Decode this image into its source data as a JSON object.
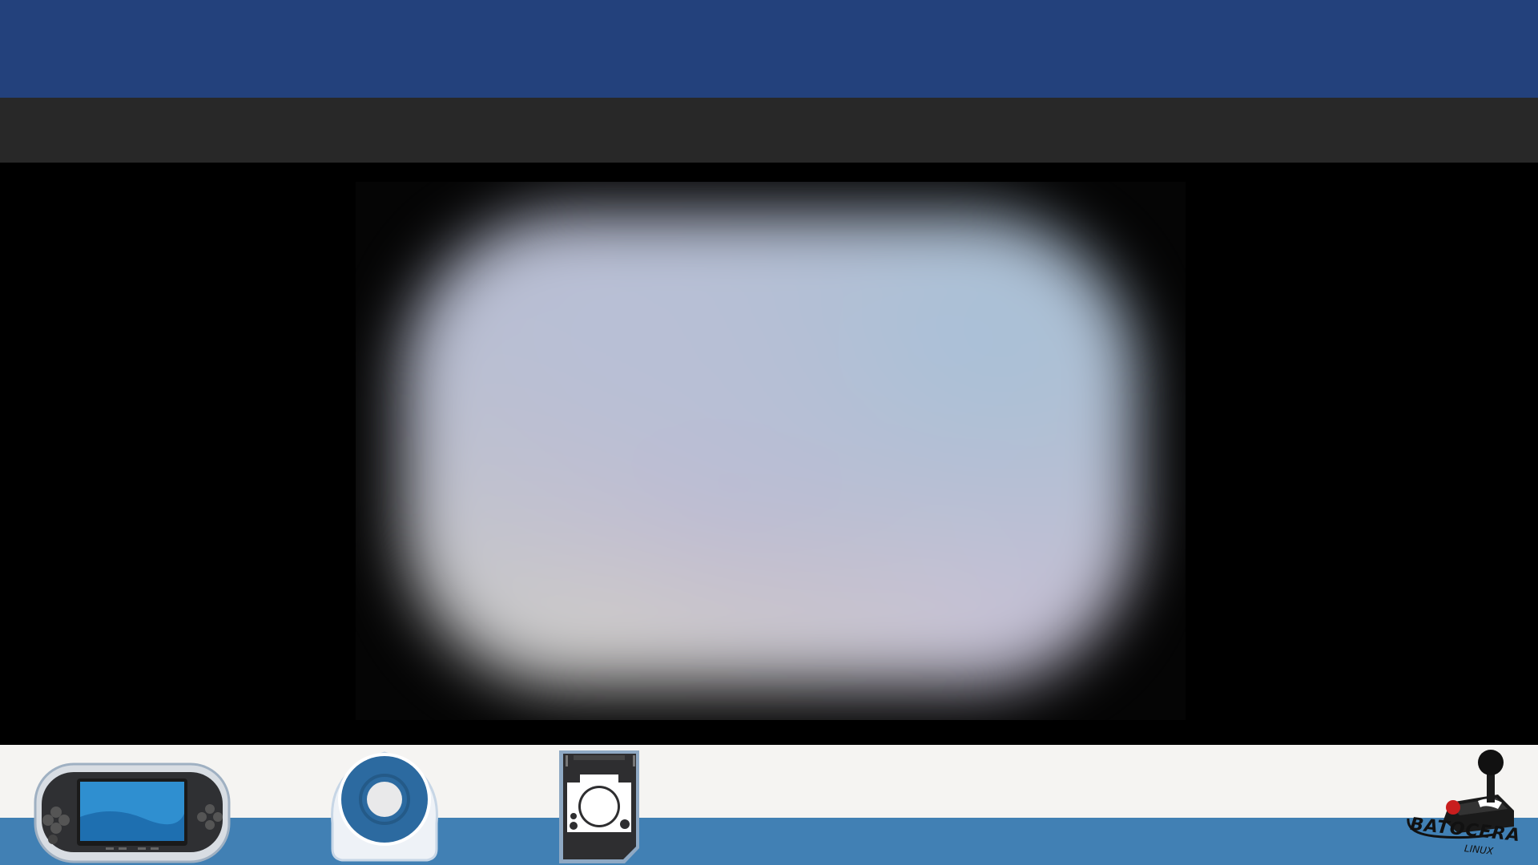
{
  "header": {
    "banner_color": "#23417c",
    "subbar_color": "#282828"
  },
  "preview": {
    "background": "#000000",
    "video": "blurred-video-preview"
  },
  "footer": {
    "bar_color": "#f5f4f2",
    "stripe_color": "#4180b4",
    "icons": [
      "psp-console-icon",
      "umd-disc-icon",
      "memory-stick-icon"
    ]
  },
  "logo": {
    "text": "BATOCERA",
    "subtext": "LINUX",
    "icon": "joystick-icon"
  }
}
